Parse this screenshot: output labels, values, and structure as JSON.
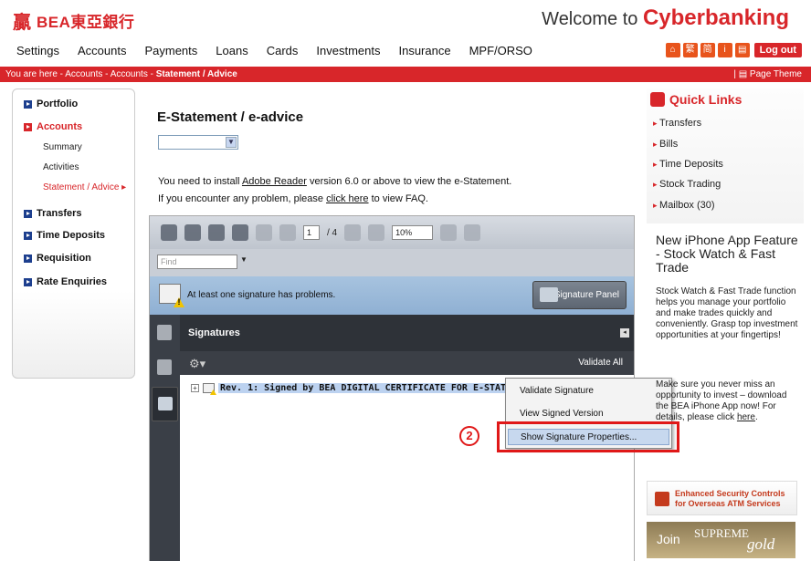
{
  "header": {
    "logo_mark": "贏",
    "logo_name": "BEA東亞銀行",
    "welcome_prefix": "Welcome to",
    "welcome_brand": "Cyberbanking"
  },
  "nav": {
    "items": [
      "Settings",
      "Accounts",
      "Payments",
      "Loans",
      "Cards",
      "Investments",
      "Insurance",
      "MPF/ORSO"
    ]
  },
  "tools": {
    "icons": [
      "home-icon",
      "chinese-trad-icon",
      "chinese-simp-icon",
      "info-icon",
      "print-icon"
    ],
    "glyphs": [
      "⌂",
      "繁",
      "简",
      "i",
      "▤"
    ],
    "logout": "Log out"
  },
  "breadcrumb": {
    "prefix": "You are here - Accounts - Accounts - ",
    "current": "Statement / Advice",
    "page_theme": "Page Theme"
  },
  "sidebar": {
    "portfolio": "Portfolio",
    "accounts": "Accounts",
    "sub": [
      "Summary",
      "Activities",
      "Statement / Advice ▸"
    ],
    "transfers": "Transfers",
    "time_deposits": "Time Deposits",
    "requisition": "Requisition",
    "rate_enquiries": "Rate Enquiries"
  },
  "content": {
    "title": "E-Statement / e-advice",
    "select_value": "",
    "info1_pre": "You need to install ",
    "info1_link": "Adobe Reader",
    "info1_post": " version 6.0 or above to view the e-Statement.",
    "info2_pre": "If you encounter any problem, please ",
    "info2_link": "click here",
    "info2_post": " to view FAQ."
  },
  "viewer": {
    "page_current": "1",
    "page_total": "/ 4",
    "zoom": "10%",
    "find_placeholder": "Find",
    "sig_warning": "At least one signature has problems.",
    "sig_panel_button": "Signature Panel",
    "panel_title": "Signatures",
    "validate_all": "Validate All",
    "sig_entry": "Rev. 1: Signed by BEA DIGITAL CERTIFICATE FOR E-STATEMENT"
  },
  "context_menu": {
    "items": [
      "Validate Signature",
      "View Signed Version",
      "Show Signature Properties..."
    ],
    "step_number": "2"
  },
  "quick_links": {
    "title": "Quick Links",
    "items": [
      "Transfers",
      "Bills",
      "Time Deposits",
      "Stock Trading",
      "Mailbox (30)"
    ]
  },
  "promo": {
    "heading": "New iPhone App Feature - Stock Watch & Fast Trade",
    "body1": "Stock Watch & Fast Trade function helps you manage your portfolio and make trades quickly and conveniently. Grasp top investment opportunities at your fingertips!",
    "body2_pre": "Make sure you never miss an opportunity to invest – download the BEA iPhone App now! For details, please click ",
    "body2_link": "here",
    "body2_post": "."
  },
  "banners": {
    "security_line1": "Enhanced Security Controls",
    "security_line2": "for Overseas ATM Services",
    "supreme_join": "Join",
    "supreme_word": "SUPREME",
    "supreme_gold": "gold"
  },
  "colors": {
    "brand_red": "#d8262a",
    "highlight_red": "#e01818",
    "menu_highlight": "#c7d8ee"
  }
}
